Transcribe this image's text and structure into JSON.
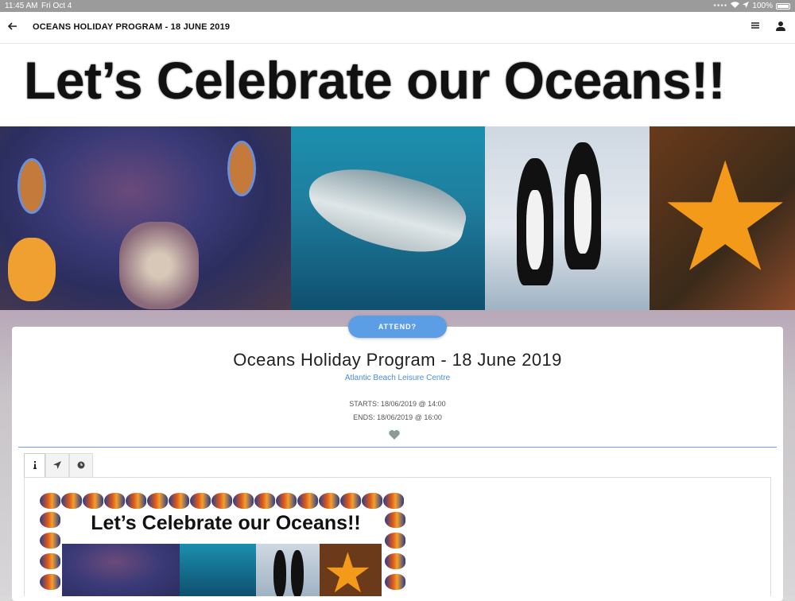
{
  "status_bar": {
    "time": "11:45 AM",
    "date": "Fri Oct 4",
    "battery": "100%"
  },
  "header": {
    "title": "OCEANS HOLIDAY PROGRAM - 18 JUNE 2019",
    "back_icon": "arrow-left-icon",
    "menu_icon": "hamburger-menu-icon",
    "user_icon": "user-icon"
  },
  "banner": {
    "headline": "Let’s Celebrate our Oceans!!"
  },
  "event": {
    "attend_label": "ATTEND?",
    "title": "Oceans Holiday Program - 18 June 2019",
    "venue": "Atlantic Beach Leisure Centre",
    "starts": "STARTS: 18/06/2019 @ 14:00",
    "ends": "ENDS: 18/06/2019 @ 16:00"
  },
  "tabs": [
    {
      "icon": "info-icon",
      "active": true
    },
    {
      "icon": "location-arrow-icon",
      "active": false
    },
    {
      "icon": "clock-icon",
      "active": false
    }
  ],
  "poster": {
    "headline": "Let’s Celebrate our Oceans!!"
  },
  "colors": {
    "accent": "#5b9ee6",
    "link": "#4a8de0",
    "divider": "#6fa3e6",
    "status_bar": "#9b9b9b"
  }
}
